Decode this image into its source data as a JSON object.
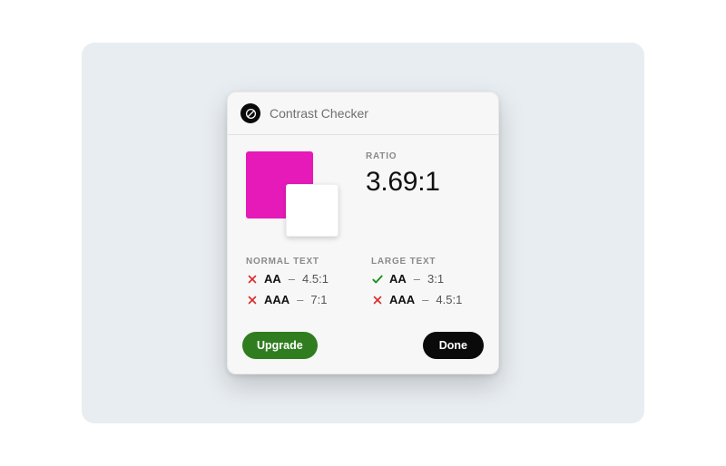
{
  "header": {
    "title": "Contrast Checker"
  },
  "swatches": {
    "back_color": "#e61ab9",
    "front_color": "#ffffff"
  },
  "ratio": {
    "label": "RATIO",
    "value": "3.69:1"
  },
  "normal_text": {
    "label": "NORMAL TEXT",
    "aa": {
      "pass": false,
      "level": "AA",
      "threshold": "4.5:1"
    },
    "aaa": {
      "pass": false,
      "level": "AAA",
      "threshold": "7:1"
    }
  },
  "large_text": {
    "label": "LARGE TEXT",
    "aa": {
      "pass": true,
      "level": "AA",
      "threshold": "3:1"
    },
    "aaa": {
      "pass": false,
      "level": "AAA",
      "threshold": "4.5:1"
    }
  },
  "footer": {
    "upgrade": "Upgrade",
    "done": "Done"
  }
}
